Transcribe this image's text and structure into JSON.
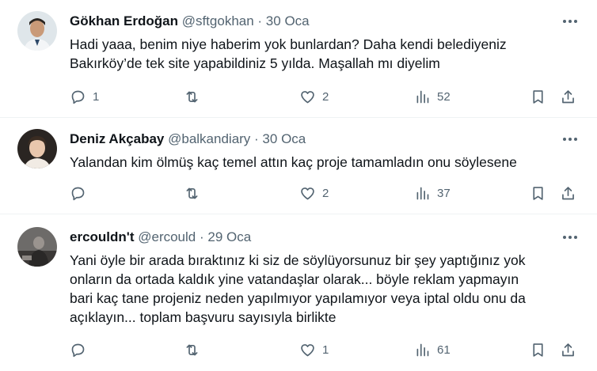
{
  "tweets": [
    {
      "name": "Gökhan Erdoğan",
      "handle": "@sftgokhan",
      "date": "· 30 Oca",
      "text": "Hadi yaaa, benim niye haberim yok bunlardan? Daha kendi belediyeniz\nBakırköy’de tek site yapabildiniz 5 yılda. Maşallah mı diyelim",
      "replies": "1",
      "reposts": "",
      "likes": "2",
      "views": "52"
    },
    {
      "name": "Deniz Akçabay",
      "handle": "@balkandiary",
      "date": "· 30 Oca",
      "text": "Yalandan kim ölmüş kaç temel attın kaç proje tamamladın onu söylesene",
      "replies": "",
      "reposts": "",
      "likes": "2",
      "views": "37"
    },
    {
      "name": "ercouldn't",
      "handle": "@ercould",
      "date": "· 29 Oca",
      "text": "Yani öyle bir arada bıraktınız ki siz de söylüyorsunuz bir şey yaptığınız yok\nonların da ortada kaldık yine vatandaşlar olarak... böyle reklam yapmayın\nbari kaç tane projeniz neden yapılmıyor yapılamıyor veya iptal oldu onu da\naçıklayın... toplam başvuru sayısıyla birlikte",
      "replies": "",
      "reposts": "",
      "likes": "1",
      "views": "61"
    }
  ],
  "icons": {
    "more": "more-horizontal-icon",
    "reply": "reply-icon",
    "repost": "repost-icon",
    "like": "heart-icon",
    "views": "views-chart-icon",
    "bookmark": "bookmark-icon",
    "share": "share-icon"
  },
  "colors": {
    "text": "#0f1419",
    "secondary": "#536471",
    "divider": "#eff3f4"
  }
}
